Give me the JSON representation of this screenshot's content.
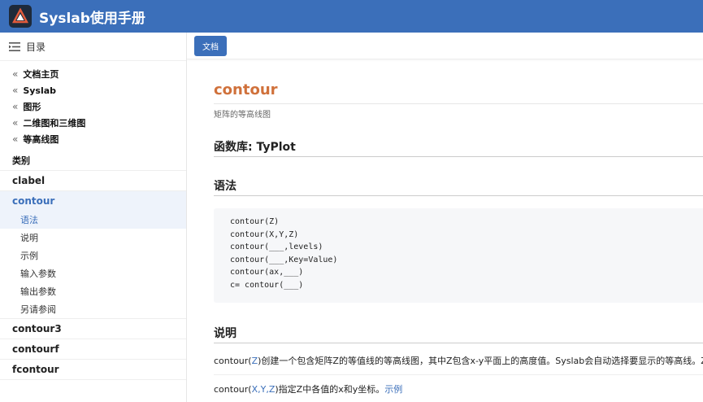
{
  "header": {
    "title": "Syslab使用手册",
    "color": "#3b6fba"
  },
  "sidebar": {
    "toc_label": "目录",
    "breadcrumbs": [
      "文档主页",
      "Syslab",
      "图形",
      "二维图和三维图",
      "等高线图"
    ],
    "category_label": "类别",
    "functions": [
      {
        "label": "clabel"
      },
      {
        "label": "contour",
        "active": true
      },
      {
        "label": "contour3"
      },
      {
        "label": "contourf"
      },
      {
        "label": "fcontour"
      }
    ],
    "contour_sections": [
      "语法",
      "说明",
      "示例",
      "输入参数",
      "输出参数",
      "另请参阅"
    ]
  },
  "toolbar": {
    "doc_button": "文档"
  },
  "doc": {
    "title": "contour",
    "subtitle": "矩阵的等高线图",
    "library": "函数库: TyPlot",
    "syntax_heading": "语法",
    "syntax_lines": [
      "contour(Z)",
      "contour(X,Y,Z)",
      "contour(___,levels)",
      "contour(___,Key=Value)",
      "contour(ax,___)",
      "c= contour(___)"
    ],
    "desc_heading": "说明",
    "desc1": {
      "pre": "contour(",
      "arg": "Z",
      "post": ")创建一个包含矩阵Z的等值线的等高线图，其中Z包含x-y平面上的高度值。Syslab会自动选择要显示的等高线。Z"
    },
    "desc2": {
      "pre": "contour(",
      "arg": "X,Y,Z",
      "mid": ")指定Z中各值的x和y坐标。",
      "link": "示例"
    }
  }
}
